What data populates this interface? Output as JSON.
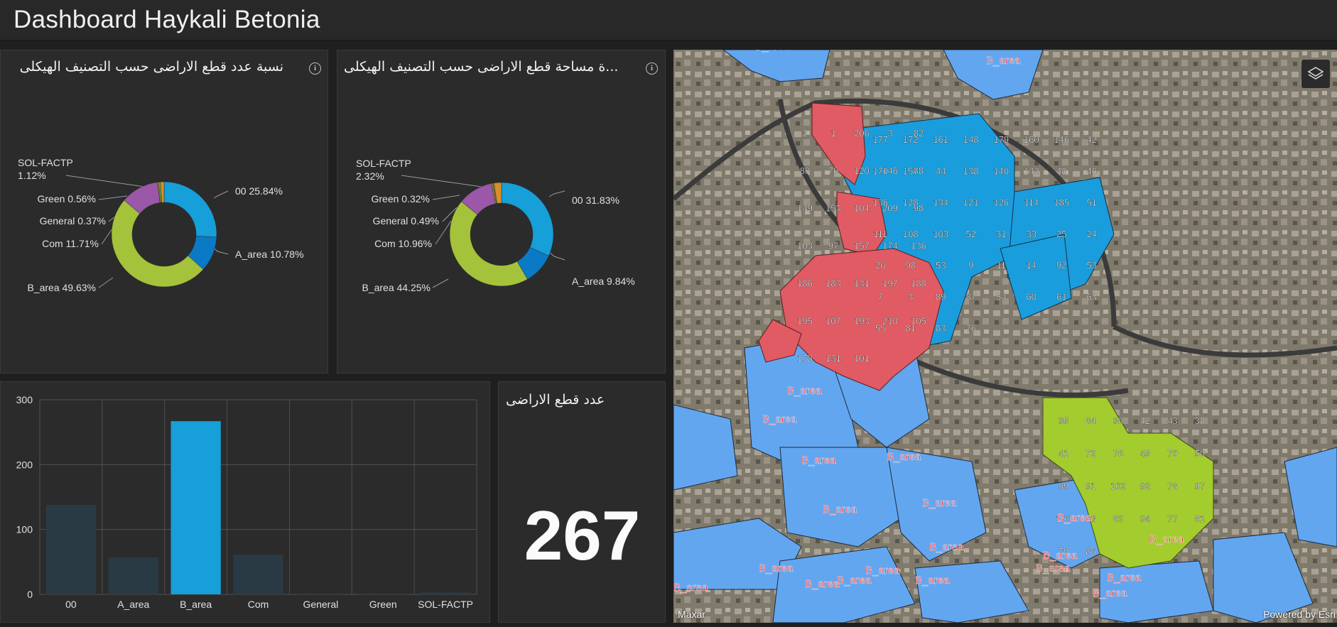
{
  "header": {
    "title": "Dashboard Haykali Betonia"
  },
  "donut1": {
    "title": "نسبة عدد قطع الاراضى حسب التصنيف الهيكلى",
    "info_icon": "info-icon",
    "labels": {
      "sol_name": "SOL-FACTP",
      "sol_pct": "1.12%",
      "green": "Green 0.56%",
      "general": "General 0.37%",
      "com": "Com 11.71%",
      "barea": "B_area 49.63%",
      "oo": "00 25.84%",
      "aarea": "A_area 10.78%"
    }
  },
  "donut2": {
    "title": "...ة مساحة قطع الاراضى حسب التصنيف الهيكلى",
    "info_icon": "info-icon",
    "labels": {
      "sol_name": "SOL-FACTP",
      "sol_pct": "2.32%",
      "green": "Green 0.32%",
      "general": "General 0.49%",
      "com": "Com 10.96%",
      "barea": "B_area 44.25%",
      "oo": "00 31.83%",
      "aarea": "A_area 9.84%"
    }
  },
  "indicator": {
    "title": "عدد قطع الاراضى",
    "value": "267"
  },
  "map": {
    "attribution_left": "Maxar",
    "attribution_right": "Powered by Esri",
    "layers_icon": "layers-icon",
    "parcel_labels_red": [
      "2",
      "1",
      "206",
      "3",
      "82",
      "80",
      "76",
      "120",
      "146",
      "88",
      "149",
      "153",
      "104",
      "209",
      "98",
      "103",
      "97",
      "157",
      "174",
      "136",
      "186",
      "183",
      "131",
      "197",
      "188",
      "195",
      "107",
      "193",
      "210",
      "105",
      "178",
      "131",
      "101"
    ],
    "parcel_labels_blue": [
      "177",
      "172",
      "161",
      "148",
      "179",
      "160",
      "146",
      "42",
      "170",
      "157",
      "44",
      "138",
      "140",
      "142",
      "48",
      "46",
      "136",
      "128",
      "134",
      "121",
      "126",
      "114",
      "185",
      "51",
      "111",
      "108",
      "103",
      "52",
      "31",
      "33",
      "25",
      "24",
      "20",
      "98",
      "53",
      "9",
      "11",
      "14",
      "92",
      "53",
      "7",
      "3",
      "89",
      "87",
      "54",
      "60",
      "61",
      "63",
      "55",
      "81",
      "83",
      "76"
    ],
    "parcel_labels_green": [
      "35",
      "84",
      "36",
      "42",
      "43",
      "38",
      "41",
      "72",
      "76",
      "45",
      "70",
      "50",
      "99",
      "91",
      "102",
      "92",
      "78",
      "97",
      "100",
      "83",
      "82",
      "94",
      "77",
      "81",
      "79",
      "86"
    ],
    "area_label": "B_area",
    "colors": {
      "red": "#e05b63",
      "blue": "#63a6f0",
      "green": "#a3cc2e"
    }
  },
  "chart_data": [
    {
      "type": "pie",
      "title": "نسبة عدد قطع الاراضى حسب التصنيف الهيكلى",
      "categories": [
        "00",
        "A_area",
        "B_area",
        "Com",
        "General",
        "Green",
        "SOL-FACTP"
      ],
      "values": [
        25.84,
        10.78,
        49.63,
        11.71,
        0.37,
        0.56,
        1.12
      ],
      "colors": [
        "#169fd8",
        "#0a7ac6",
        "#a4c23a",
        "#9b57a8",
        "#a28a2e",
        "#7aa431",
        "#d58f2a"
      ]
    },
    {
      "type": "pie",
      "title": "...ة مساحة قطع الاراضى حسب التصنيف الهيكلى",
      "categories": [
        "00",
        "A_area",
        "B_area",
        "Com",
        "General",
        "Green",
        "SOL-FACTP"
      ],
      "values": [
        31.83,
        9.84,
        44.25,
        10.96,
        0.49,
        0.32,
        2.32
      ],
      "colors": [
        "#169fd8",
        "#0a7ac6",
        "#a4c23a",
        "#9b57a8",
        "#a28a2e",
        "#7aa431",
        "#d58f2a"
      ]
    },
    {
      "type": "bar",
      "categories": [
        "00",
        "A_area",
        "B_area",
        "Com",
        "General",
        "Green",
        "SOL-FACTP"
      ],
      "values": [
        138,
        57,
        267,
        61,
        1,
        1,
        3
      ],
      "ylim": [
        0,
        300
      ],
      "yticks": [
        0,
        100,
        200,
        300
      ],
      "colors": {
        "default": "#2a3a45",
        "highlight": "#169fd8"
      },
      "highlight_index": 2,
      "grid": true
    }
  ]
}
